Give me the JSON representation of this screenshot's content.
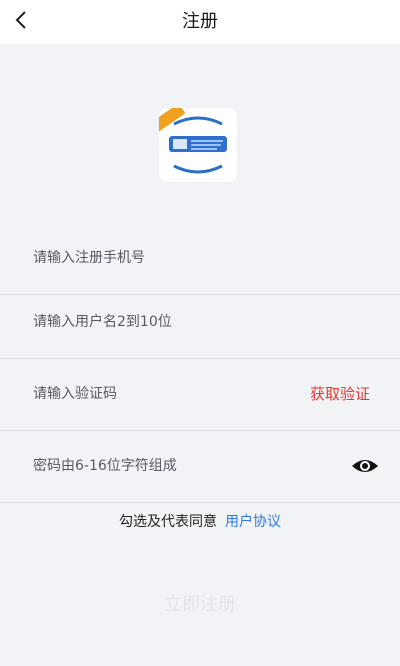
{
  "header": {
    "title": "注册"
  },
  "form": {
    "phone_placeholder": "请输入注册手机号",
    "username_placeholder": "请输入用户名2到10位",
    "code_placeholder": "请输入验证码",
    "get_code_label": "获取验证",
    "password_placeholder": "密码由6-16位字符组成"
  },
  "agreement": {
    "text": "勾选及代表同意",
    "link": "用户协议"
  },
  "submit_label": "立即注册",
  "colors": {
    "accent_red": "#e53a2f",
    "link_blue": "#2f77e6",
    "background": "#f2f3f7"
  },
  "icons": [
    "back-arrow-icon",
    "app-logo",
    "eye-icon"
  ]
}
